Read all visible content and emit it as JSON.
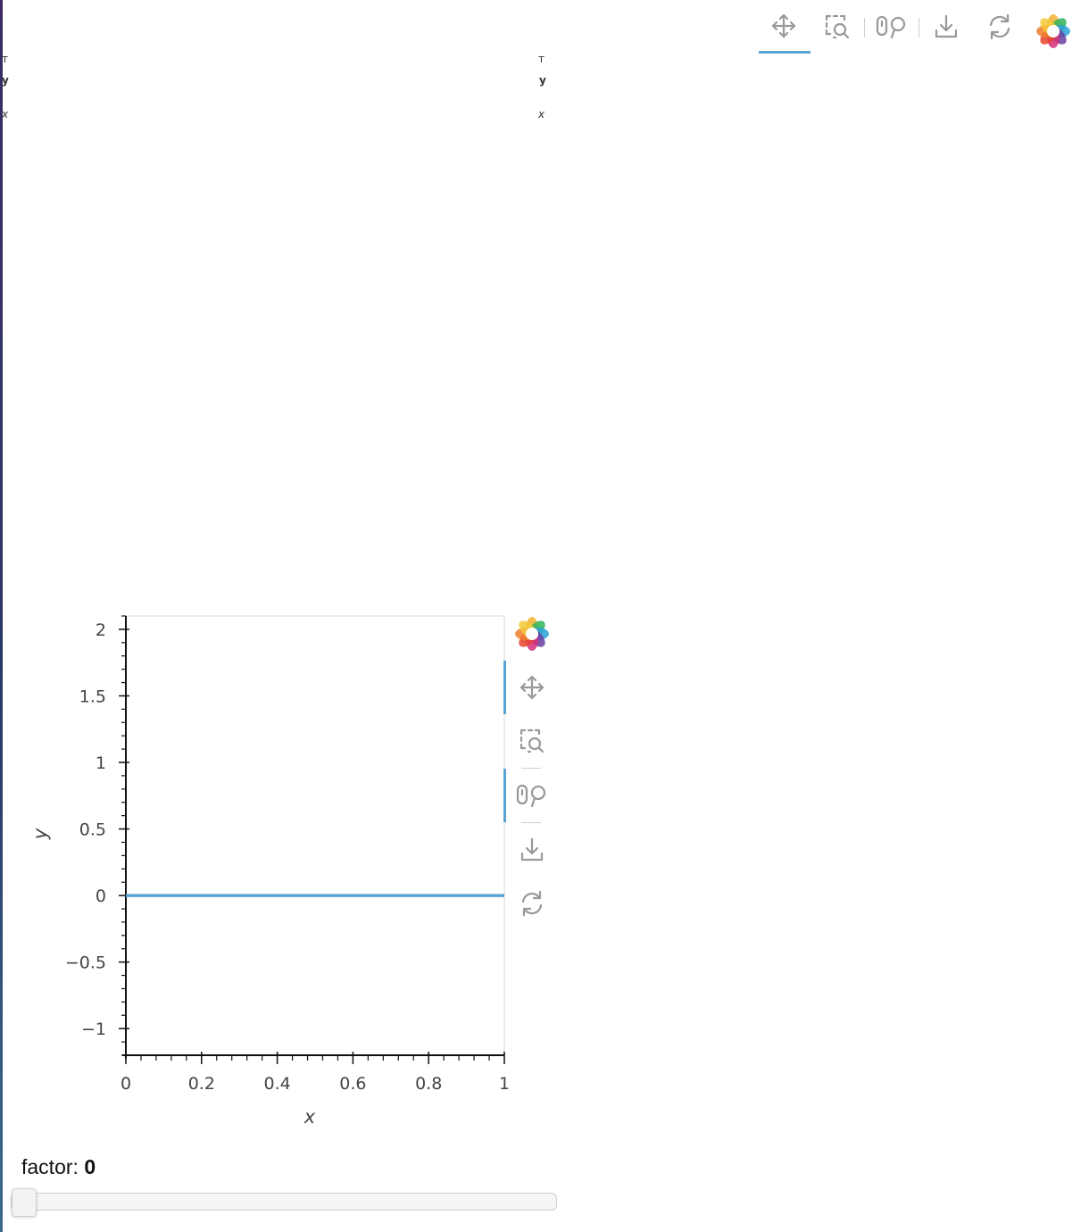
{
  "top_toolbar": {
    "tools": [
      {
        "name": "pan",
        "icon": "pan-icon",
        "active": true
      },
      {
        "name": "box-zoom",
        "icon": "box-zoom-icon",
        "active": false
      },
      {
        "name": "wheel-zoom",
        "icon": "wheel-zoom-icon",
        "active": false
      },
      {
        "name": "save",
        "icon": "download-icon",
        "active": false
      },
      {
        "name": "reset",
        "icon": "reset-icon",
        "active": false
      }
    ],
    "logo": "bokeh-logo"
  },
  "collapsed_plots": [
    {
      "y_label": "y",
      "x_label": "x"
    },
    {
      "y_label": "y",
      "x_label": "x"
    }
  ],
  "chart_data": {
    "type": "line",
    "x": [
      0,
      1
    ],
    "series": [
      {
        "values": [
          0,
          0
        ]
      }
    ],
    "xlabel": "x",
    "ylabel": "y",
    "xlim": [
      0,
      1
    ],
    "ylim": [
      -1.2,
      2.1
    ],
    "x_ticks": [
      "0",
      "0.2",
      "0.4",
      "0.6",
      "0.8",
      "1"
    ],
    "y_ticks": [
      "2",
      "1.5",
      "1",
      "0.5",
      "0",
      "−0.5",
      "−1"
    ],
    "colors": {
      "line": "#5aa3d4"
    }
  },
  "side_toolbar": {
    "tools": [
      {
        "name": "pan",
        "icon": "pan-icon",
        "active": true
      },
      {
        "name": "box-zoom",
        "icon": "box-zoom-icon",
        "active": false
      },
      {
        "name": "wheel-zoom",
        "icon": "wheel-zoom-icon",
        "active": true
      },
      {
        "name": "save",
        "icon": "download-icon",
        "active": false
      },
      {
        "name": "reset",
        "icon": "reset-icon",
        "active": false
      }
    ]
  },
  "slider": {
    "label": "factor: ",
    "value": "0",
    "min": 0,
    "max": 1,
    "current": 0
  }
}
